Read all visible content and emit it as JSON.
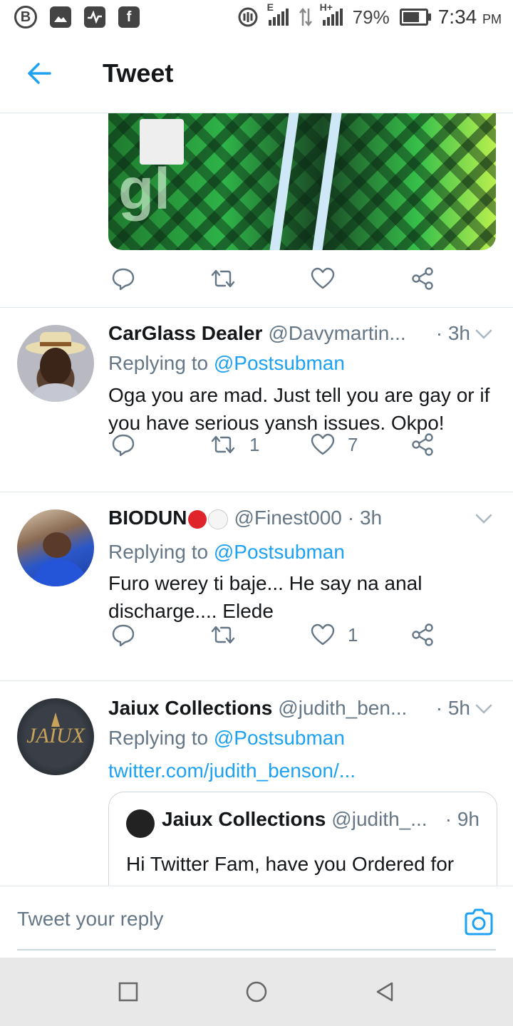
{
  "status_bar": {
    "battery_percent": "79%",
    "time": "7:34",
    "ampm": "PM",
    "network_label_1": "E",
    "network_label_2": "H+",
    "battery_level": 0.79
  },
  "header": {
    "title": "Tweet"
  },
  "actions_top": {
    "reply_count": "",
    "retweet_count": "",
    "like_count": ""
  },
  "replies": [
    {
      "name": "CarGlass Dealer",
      "handle": "@Davymartin...",
      "time": "· 3h",
      "replying_prefix": "Replying to ",
      "replying_to": "@Postsubman",
      "text": "Oga you are mad. Just tell you are gay or if you have serious yansh issues. Okpo!",
      "retweets": "1",
      "likes": "7"
    },
    {
      "name": "BIODUN",
      "handle": "@Finest000",
      "time": "· 3h",
      "replying_prefix": "Replying to ",
      "replying_to": "@Postsubman",
      "text": "Furo werey ti baje... He say na anal discharge.... Elede",
      "retweets": "",
      "likes": "1"
    },
    {
      "name": "Jaiux Collections",
      "handle": "@judith_ben...",
      "time": "· 5h",
      "replying_prefix": "Replying to ",
      "replying_to": "@Postsubman",
      "link": "twitter.com/judith_benson/...",
      "quote": {
        "name": "Jaiux Collections",
        "handle": "@judith_...",
        "time": "· 9h",
        "text": "Hi Twitter Fam, have you Ordered for"
      }
    }
  ],
  "composer": {
    "placeholder": "Tweet your reply"
  },
  "colors": {
    "accent": "#1da1f2",
    "divider": "#e1e8ed",
    "secondary_text": "#657786",
    "record_red": "#e0242b"
  }
}
